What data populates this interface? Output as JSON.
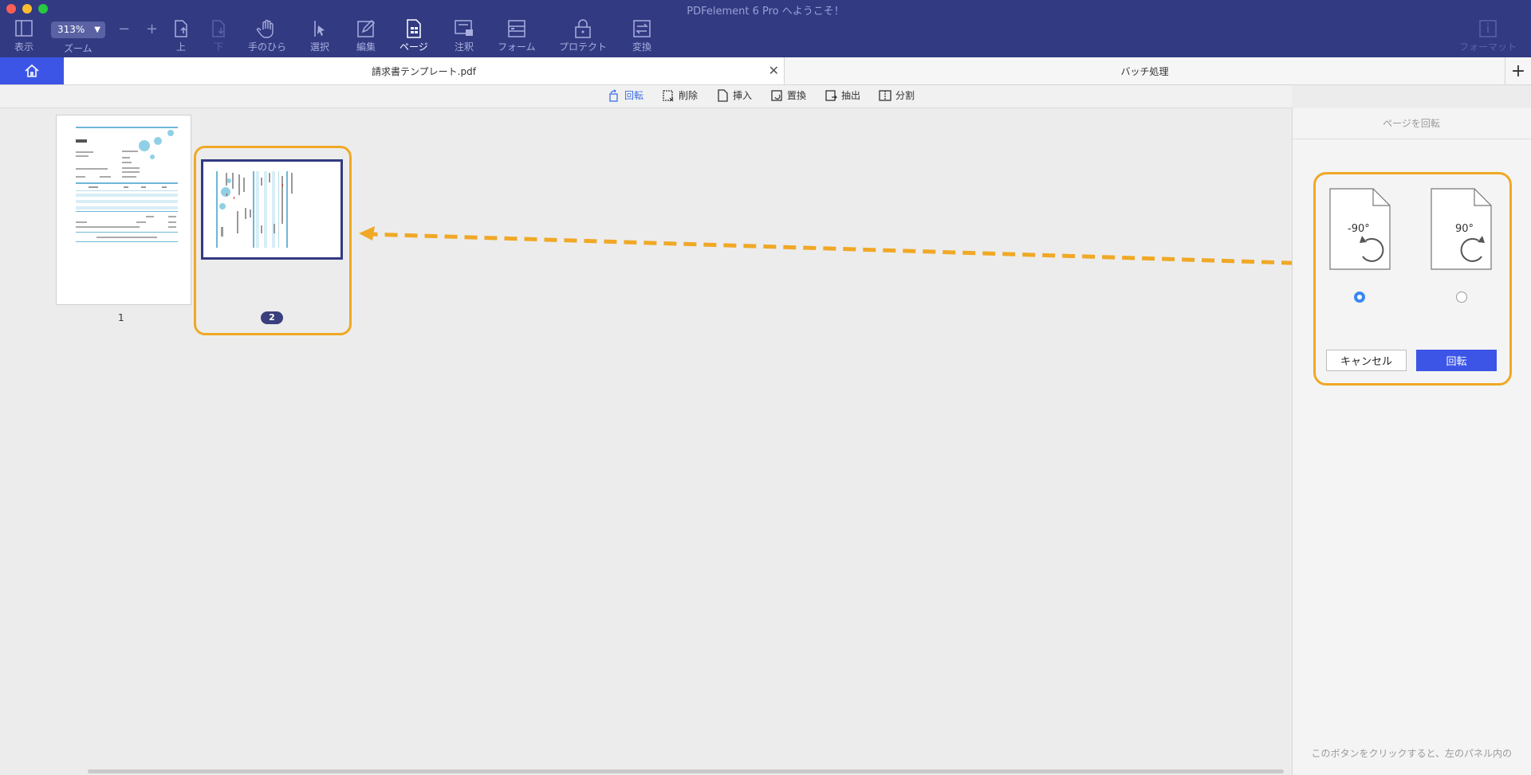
{
  "app": {
    "title": "PDFelement 6 Pro へようこそ！"
  },
  "toolbar": {
    "view": "表示",
    "zoom_value": "313%",
    "zoom_label": "ズーム",
    "zoom_minus": "−",
    "zoom_plus": "+",
    "up": "上",
    "down": "下",
    "hand": "手のひら",
    "select": "選択",
    "edit": "編集",
    "page": "ページ",
    "comment": "注釈",
    "form": "フォーム",
    "protect": "プロテクト",
    "convert": "変換",
    "format": "フォーマット"
  },
  "tabs": {
    "document": "請求書テンプレート.pdf",
    "close": "✕",
    "batch": "バッチ処理",
    "add": "+"
  },
  "page_tools": {
    "rotate": "回転",
    "delete": "削除",
    "insert": "挿入",
    "replace": "置換",
    "extract": "抽出",
    "split": "分割"
  },
  "thumbnails": {
    "page1_number": "1",
    "page2_number": "2"
  },
  "right_panel": {
    "title": "ページを回転",
    "left_angle": "-90°",
    "right_angle": "90°",
    "cancel": "キャンセル",
    "rotate": "回転",
    "hint": "このボタンをクリックすると、左のパネル内の"
  },
  "colors": {
    "toolbar_bg": "#323a82",
    "accent_blue": "#3c55e6",
    "highlight_orange": "#f0a825"
  }
}
